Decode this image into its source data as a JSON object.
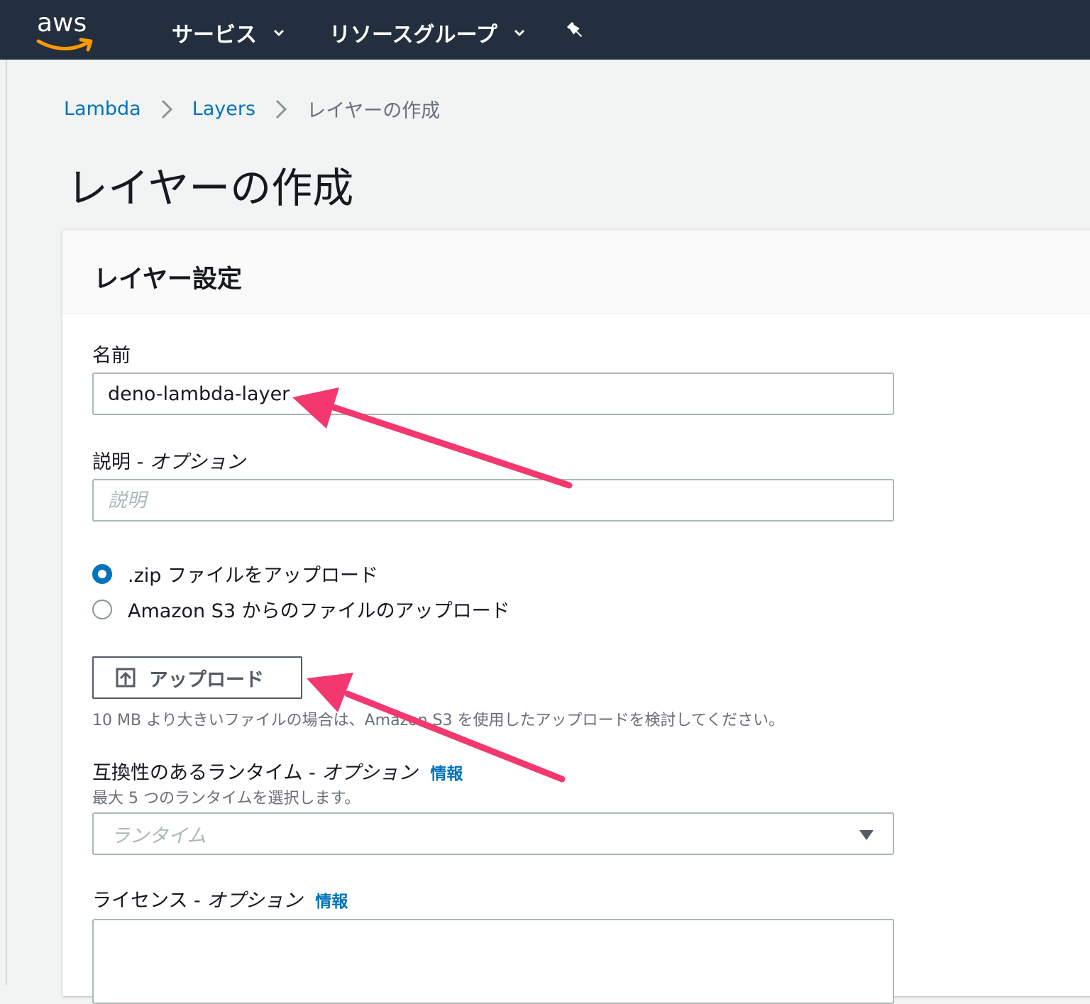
{
  "topnav": {
    "logo_text": "aws",
    "services_label": "サービス",
    "resource_groups_label": "リソースグループ",
    "pin_icon": "pin-icon"
  },
  "breadcrumb": {
    "items": [
      "Lambda",
      "Layers"
    ],
    "current": "レイヤーの作成"
  },
  "page": {
    "title": "レイヤーの作成"
  },
  "panel": {
    "title": "レイヤー設定",
    "name": {
      "label": "名前",
      "value": "deno-lambda-layer"
    },
    "description": {
      "label": "説明 - ",
      "label_optional": "オプション",
      "placeholder": "説明"
    },
    "upload_options": [
      {
        "label": ".zip ファイルをアップロード",
        "selected": true
      },
      {
        "label": "Amazon S3 からのファイルのアップロード",
        "selected": false
      }
    ],
    "upload_button_label": "アップロード",
    "upload_hint": "10 MB より大きいファイルの場合は、Amazon S3 を使用したアップロードを検討してください。",
    "runtimes": {
      "label": "互換性のあるランタイム - ",
      "label_optional": "オプション",
      "info": "情報",
      "hint": "最大 5 つのランタイムを選択します。",
      "placeholder": "ランタイム"
    },
    "license": {
      "label": "ライセンス - ",
      "label_optional": "オプション",
      "info": "情報"
    }
  },
  "colors": {
    "nav_bg": "#232f3e",
    "link": "#0073bb",
    "aws_orange": "#ff9900",
    "annotation_arrow": "#f2386f"
  }
}
